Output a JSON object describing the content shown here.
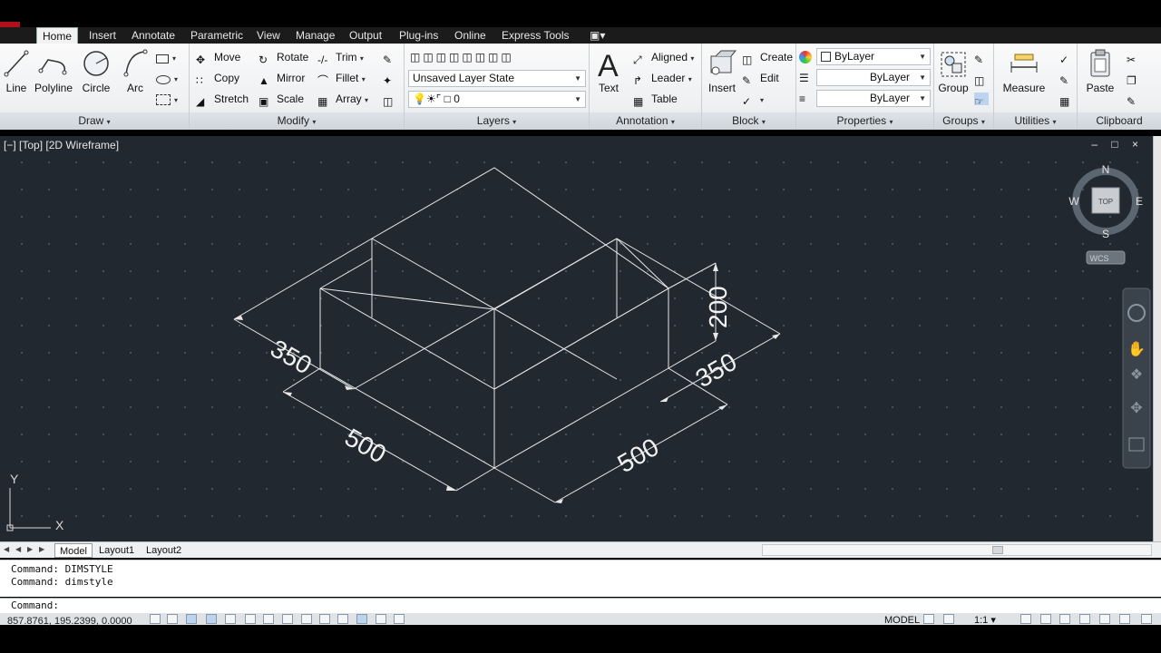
{
  "ribbon": {
    "tabs": [
      "Home",
      "Insert",
      "Annotate",
      "Parametric",
      "View",
      "Manage",
      "Output",
      "Plug-ins",
      "Online",
      "Express Tools"
    ],
    "draw": {
      "title": "Draw",
      "line": "Line",
      "polyline": "Polyline",
      "circle": "Circle",
      "arc": "Arc"
    },
    "modify": {
      "title": "Modify",
      "move": "Move",
      "rotate": "Rotate",
      "trim": "Trim",
      "copy": "Copy",
      "mirror": "Mirror",
      "fillet": "Fillet",
      "stretch": "Stretch",
      "scale": "Scale",
      "array": "Array"
    },
    "layers": {
      "title": "Layers",
      "state": "Unsaved Layer State",
      "current": "0"
    },
    "annotation": {
      "title": "Annotation",
      "text": "Text",
      "aligned": "Aligned",
      "leader": "Leader",
      "table": "Table"
    },
    "block": {
      "title": "Block",
      "insert": "Insert",
      "create": "Create",
      "edit": "Edit"
    },
    "properties": {
      "title": "Properties",
      "color": "ByLayer",
      "lineweight": "ByLayer",
      "linetype": "ByLayer"
    },
    "groups": {
      "title": "Groups",
      "group": "Group"
    },
    "utilities": {
      "title": "Utilities",
      "measure": "Measure"
    },
    "clipboard": {
      "title": "Clipboard",
      "paste": "Paste"
    }
  },
  "viewport": {
    "label": "[−] [Top] [2D Wireframe]",
    "controls": "– □ ×",
    "viewcube": {
      "n": "N",
      "s": "S",
      "e": "E",
      "w": "W",
      "face": "TOP",
      "ucs": "WCS"
    },
    "ucs_icon": {
      "y": "Y",
      "x": "X"
    },
    "dimensions": [
      "350",
      "500",
      "500",
      "350",
      "200"
    ]
  },
  "layout_tabs": [
    "Model",
    "Layout1",
    "Layout2"
  ],
  "command_history": [
    "Command: DIMSTYLE",
    "Command: dimstyle"
  ],
  "command_prompt": "Command:",
  "status": {
    "coords": "857.8761, 195.2399, 0.0000",
    "model": "MODEL",
    "scale": "1:1"
  }
}
